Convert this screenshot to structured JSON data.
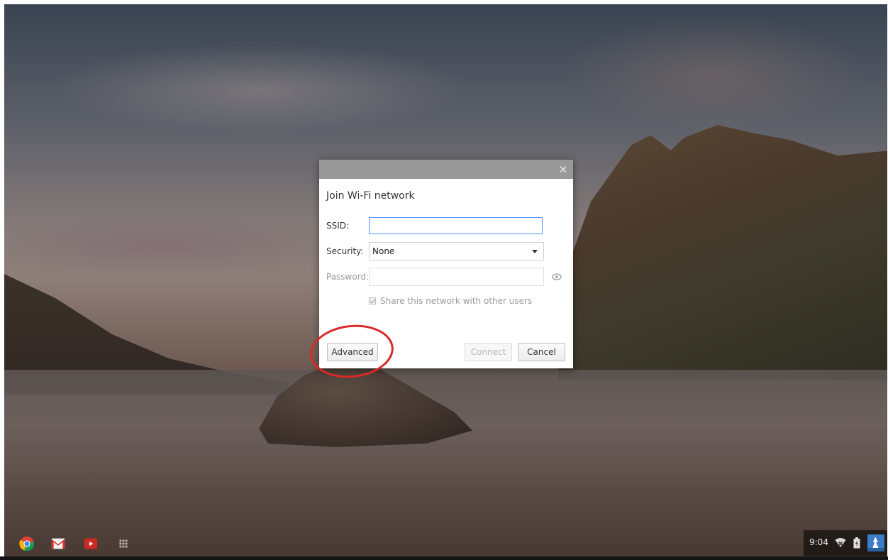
{
  "dialog": {
    "title": "Join Wi-Fi network",
    "close_glyph": "✕",
    "ssid_label": "SSID:",
    "ssid_value": "",
    "security_label": "Security:",
    "security_value": "None",
    "password_label": "Password:",
    "password_value": "",
    "share_label": "Share this network with other users",
    "share_checked": true,
    "advanced_label": "Advanced",
    "connect_label": "Connect",
    "cancel_label": "Cancel"
  },
  "shelf": {
    "apps": [
      "chrome-icon",
      "gmail-icon",
      "youtube-icon",
      "app-launcher-icon"
    ]
  },
  "tray": {
    "time": "9:04",
    "icons": [
      "network-icon",
      "battery-icon",
      "user-avatar-icon"
    ]
  },
  "colors": {
    "annotation": "#d92828",
    "focus_border": "#4d90fe",
    "titlebar": "#999999"
  }
}
